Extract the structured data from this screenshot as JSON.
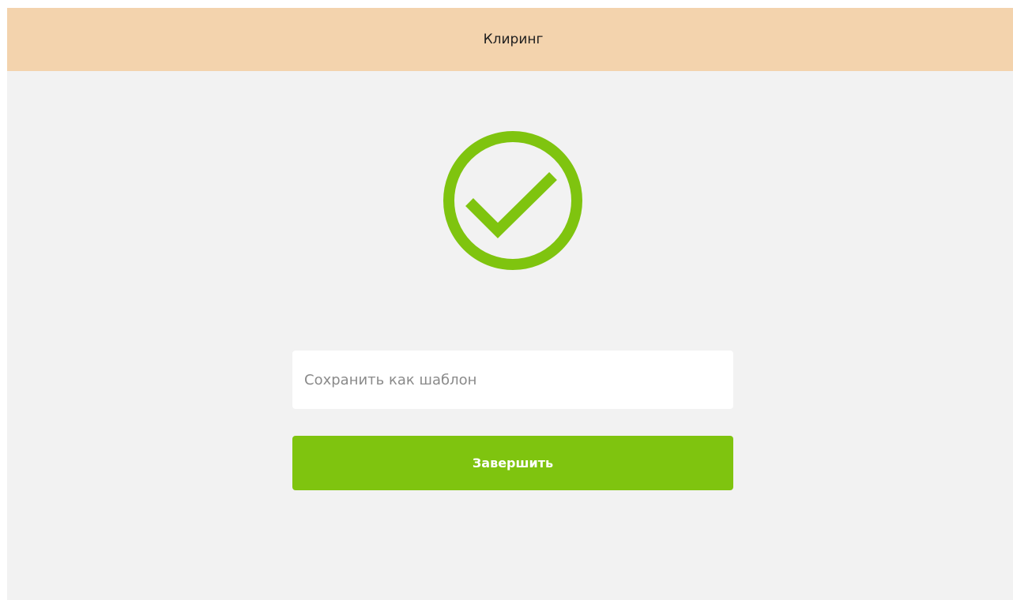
{
  "header": {
    "title": "Клиринг"
  },
  "result": {
    "icon": "check-circle-icon",
    "color": "#7fc40f"
  },
  "template": {
    "placeholder": "Сохранить как шаблон",
    "value": ""
  },
  "actions": {
    "finish_label": "Завершить"
  },
  "colors": {
    "header_bg": "#f3d3ad",
    "page_bg": "#f2f2f2",
    "accent": "#7fc40f"
  }
}
